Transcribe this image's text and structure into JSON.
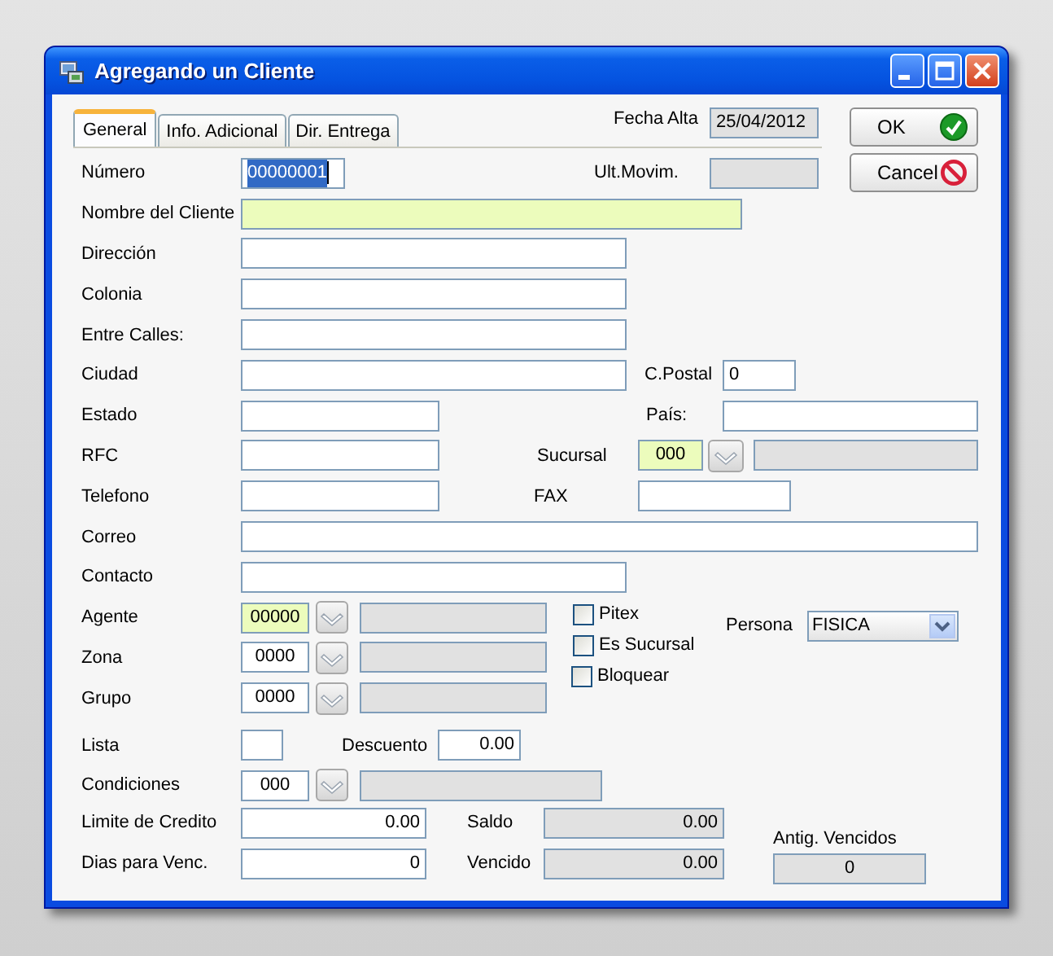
{
  "window": {
    "title": "Agregando un Cliente"
  },
  "rows": [
    {
      "items": [
        {
          "kind": "tabs",
          "tabs": [
            {
              "label": "General",
              "selected": true
            },
            {
              "label": "Info. Adicional",
              "selected": false
            },
            {
              "label": "Dir. Entrega",
              "selected": false
            }
          ]
        },
        {
          "kind": "label",
          "text": "Fecha Alta"
        },
        {
          "kind": "input",
          "value": "25/04/2012",
          "disabled": true
        },
        {
          "kind": "confirm",
          "label": "OK"
        }
      ]
    },
    {
      "items": [
        {
          "kind": "label",
          "text": "Número"
        },
        {
          "kind": "input",
          "value": "00000001",
          "disabled": false,
          "highlighted": false,
          "text_selected": true
        },
        {
          "kind": "label",
          "text": "Ult.Movim."
        },
        {
          "kind": "input",
          "disabled": true
        },
        {
          "kind": "cancel",
          "label": "Cancel"
        }
      ]
    },
    {
      "items": [
        {
          "kind": "label",
          "text": "Nombre del Cliente"
        },
        {
          "kind": "input",
          "disabled": false,
          "highlighted": true
        }
      ]
    },
    {
      "items": [
        {
          "kind": "label",
          "text": "Dirección"
        },
        {
          "kind": "input",
          "disabled": false,
          "highlighted": false
        }
      ]
    },
    {
      "items": [
        {
          "kind": "label",
          "text": "Colonia"
        },
        {
          "kind": "input",
          "disabled": false,
          "highlighted": false
        }
      ]
    },
    {
      "items": [
        {
          "kind": "label",
          "text": "Entre Calles:"
        },
        {
          "kind": "input",
          "disabled": false,
          "highlighted": false
        }
      ]
    },
    {
      "items": [
        {
          "kind": "label",
          "text": "Ciudad"
        },
        {
          "kind": "input",
          "disabled": false,
          "highlighted": false
        },
        {
          "kind": "label",
          "text": "C.Postal"
        },
        {
          "kind": "input",
          "value": "0",
          "disabled": false,
          "highlighted": false
        }
      ]
    },
    {
      "items": [
        {
          "kind": "label",
          "text": "Estado"
        },
        {
          "kind": "input",
          "disabled": false,
          "highlighted": false
        },
        {
          "kind": "label",
          "text": "País:"
        },
        {
          "kind": "input",
          "disabled": false,
          "highlighted": false
        }
      ]
    },
    {
      "items": [
        {
          "kind": "label",
          "text": "RFC"
        },
        {
          "kind": "input",
          "disabled": false,
          "highlighted": false
        },
        {
          "kind": "label",
          "text": "Sucursal"
        },
        {
          "kind": "input",
          "value": "000",
          "disabled": false,
          "highlighted": true
        },
        {
          "kind": "dropdown"
        },
        {
          "kind": "input",
          "disabled": true
        }
      ]
    },
    {
      "items": [
        {
          "kind": "label",
          "text": "Telefono"
        },
        {
          "kind": "input",
          "disabled": false,
          "highlighted": false
        },
        {
          "kind": "label",
          "text": "FAX"
        },
        {
          "kind": "input",
          "disabled": false,
          "highlighted": false
        }
      ]
    },
    {
      "items": [
        {
          "kind": "label",
          "text": "Correo"
        },
        {
          "kind": "input",
          "disabled": false,
          "highlighted": false
        }
      ]
    },
    {
      "items": [
        {
          "kind": "label",
          "text": "Contacto"
        },
        {
          "kind": "input",
          "disabled": false,
          "highlighted": false
        }
      ]
    },
    {
      "columns": [
        {
          "rows": [
            {
              "items": [
                {
                  "kind": "label",
                  "text": "Agente"
                },
                {
                  "kind": "input",
                  "value": "00000",
                  "disabled": false,
                  "highlighted": true
                },
                {
                  "kind": "dropdown"
                },
                {
                  "kind": "input",
                  "disabled": true
                }
              ]
            },
            {
              "items": [
                {
                  "kind": "label",
                  "text": "Zona"
                },
                {
                  "kind": "input",
                  "value": "0000",
                  "disabled": false,
                  "highlighted": false
                },
                {
                  "kind": "dropdown"
                },
                {
                  "kind": "input",
                  "disabled": true
                }
              ]
            },
            {
              "items": [
                {
                  "kind": "label",
                  "text": "Grupo"
                },
                {
                  "kind": "input",
                  "value": "0000",
                  "disabled": false,
                  "highlighted": false
                },
                {
                  "kind": "dropdown"
                },
                {
                  "kind": "input",
                  "disabled": true
                }
              ]
            }
          ]
        },
        {
          "rows": [
            {
              "items": [
                {
                  "kind": "checkbox",
                  "checked": false
                },
                {
                  "kind": "label",
                  "text": "Pitex"
                }
              ]
            },
            {
              "items": [
                {
                  "kind": "checkbox",
                  "checked": false
                },
                {
                  "kind": "label",
                  "text": "Es Sucursal"
                }
              ]
            },
            {
              "items": [
                {
                  "kind": "checkbox",
                  "checked": false
                },
                {
                  "kind": "label",
                  "text": "Bloquear"
                }
              ]
            }
          ]
        },
        {
          "rows": [
            {
              "items": [
                {
                  "kind": "label",
                  "text": "Persona"
                },
                {
                  "kind": "select",
                  "value": "FISICA"
                }
              ]
            }
          ]
        }
      ]
    },
    {
      "items": [
        {
          "kind": "label",
          "text": "Lista"
        },
        {
          "kind": "input",
          "disabled": false,
          "highlighted": false
        },
        {
          "kind": "label",
          "text": "Descuento"
        },
        {
          "kind": "input",
          "value": "0.00",
          "disabled": false,
          "highlighted": false
        }
      ]
    },
    {
      "items": [
        {
          "kind": "label",
          "text": "Condiciones"
        },
        {
          "kind": "input",
          "value": "000",
          "disabled": false,
          "highlighted": false
        },
        {
          "kind": "dropdown"
        },
        {
          "kind": "input",
          "disabled": true
        }
      ]
    },
    {
      "columns": [
        {
          "rows": [
            {
              "items": [
                {
                  "kind": "label",
                  "text": "Limite de Credito"
                },
                {
                  "kind": "input",
                  "value": "0.00",
                  "disabled": false,
                  "highlighted": false
                }
              ]
            },
            {
              "items": [
                {
                  "kind": "label",
                  "text": "Dias para Venc."
                },
                {
                  "kind": "input",
                  "value": "0",
                  "disabled": false,
                  "highlighted": false
                }
              ]
            }
          ]
        },
        {
          "rows": [
            {
              "items": [
                {
                  "kind": "label",
                  "text": "Saldo"
                },
                {
                  "kind": "input",
                  "value": "0.00",
                  "disabled": true
                }
              ]
            },
            {
              "items": [
                {
                  "kind": "label",
                  "text": "Vencido"
                },
                {
                  "kind": "input",
                  "value": "0.00",
                  "disabled": true
                }
              ]
            }
          ]
        },
        {
          "rows": [
            {
              "items": [
                {
                  "kind": "label",
                  "text": "Antig. Vencidos"
                }
              ]
            },
            {
              "items": [
                {
                  "kind": "input",
                  "value": "0",
                  "disabled": true
                }
              ]
            }
          ]
        }
      ]
    }
  ]
}
